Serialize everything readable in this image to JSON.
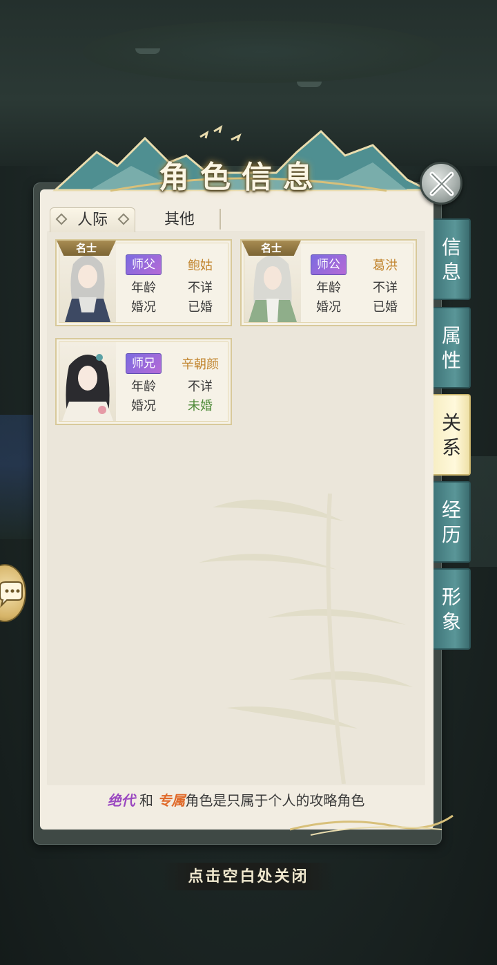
{
  "title": "角色信息",
  "tabs": [
    {
      "label": "人际",
      "active": true
    },
    {
      "label": "其他",
      "active": false
    }
  ],
  "side_tabs": [
    {
      "label": "信息",
      "chars": [
        "信",
        "息"
      ],
      "active": false
    },
    {
      "label": "属性",
      "chars": [
        "属",
        "性"
      ],
      "active": false
    },
    {
      "label": "关系",
      "chars": [
        "关",
        "系"
      ],
      "active": true
    },
    {
      "label": "经历",
      "chars": [
        "经",
        "历"
      ],
      "active": false
    },
    {
      "label": "形象",
      "chars": [
        "形",
        "象"
      ],
      "active": false
    }
  ],
  "relations": [
    {
      "fame_tag": "名士",
      "role": "师父",
      "name": "鲍姑",
      "age_label": "年龄",
      "age": "不详",
      "marital_label": "婚况",
      "marital": "已婚"
    },
    {
      "fame_tag": "名士",
      "role": "师公",
      "name": "葛洪",
      "age_label": "年龄",
      "age": "不详",
      "marital_label": "婚况",
      "marital": "已婚"
    },
    {
      "fame_tag": "",
      "role": "师兄",
      "name": "辛朝颜",
      "age_label": "年龄",
      "age": "不详",
      "marital_label": "婚况",
      "marital": "未婚"
    }
  ],
  "note": {
    "part1": "绝代",
    "part2": " 和 ",
    "part3": "专属",
    "part4": "角色是只属于个人的攻略角色"
  },
  "close_hint": "点击空白处关闭",
  "colors": {
    "accent_teal": "#5a9698",
    "active_tab": "#fff9dc",
    "role_badge": "#8f6bdc",
    "name_gold": "#c1842d",
    "unmarried_green": "#4d8a38"
  }
}
